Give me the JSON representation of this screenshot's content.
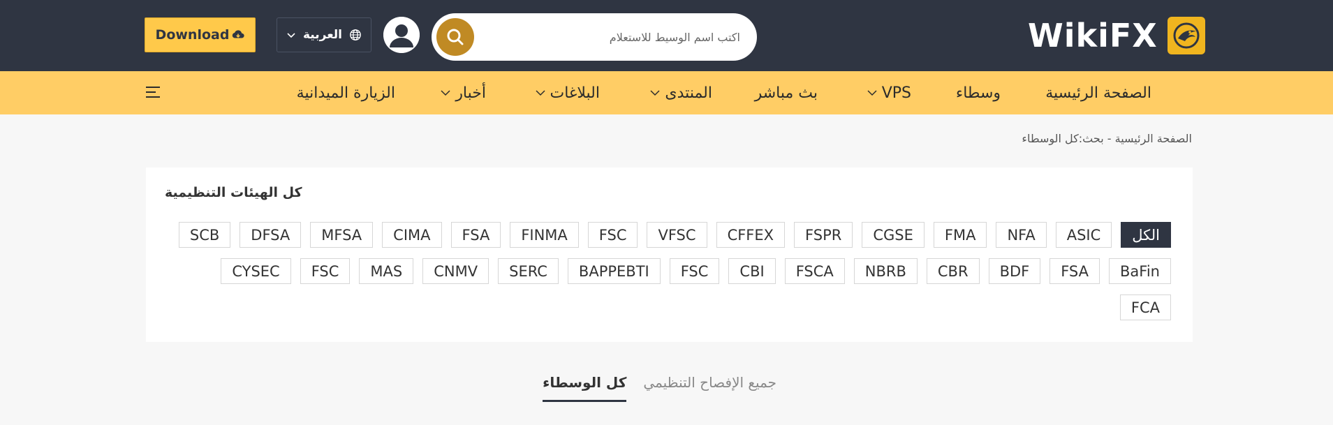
{
  "header": {
    "download_label": "Download",
    "language_label": "العربية",
    "search_placeholder": "اكتب اسم الوسيط للاستعلام",
    "logo_text": "WikiFX"
  },
  "nav": {
    "items": [
      {
        "label": "الصفحة الرئيسية",
        "dropdown": false
      },
      {
        "label": "وسطاء",
        "dropdown": false
      },
      {
        "label": "VPS",
        "dropdown": true
      },
      {
        "label": "بث مباشر",
        "dropdown": false
      },
      {
        "label": "المنتدى",
        "dropdown": true
      },
      {
        "label": "البلاغات",
        "dropdown": true
      },
      {
        "label": "أخبار",
        "dropdown": true
      },
      {
        "label": "الزيارة الميدانية",
        "dropdown": false
      }
    ]
  },
  "breadcrumb": {
    "home": "الصفحة الرئيسية",
    "separator": "-",
    "current": "بحث:كل الوسطاء"
  },
  "filter": {
    "title": "كل الهيئات التنظيمية",
    "rows": [
      [
        "الكل",
        "ASIC",
        "NFA",
        "FMA",
        "CGSE",
        "FSPR",
        "CFFEX",
        "VFSC",
        "FSC",
        "FINMA",
        "FSA",
        "CIMA",
        "MFSA",
        "DFSA",
        "SCB"
      ],
      [
        "BaFin",
        "FSA",
        "BDF",
        "CBR",
        "NBRB",
        "FSCA",
        "CBI",
        "FSC",
        "BAPPEBTI",
        "SERC",
        "CNMV",
        "MAS",
        "FSC",
        "CYSEC"
      ],
      [
        "FCA"
      ]
    ],
    "active": "الكل"
  },
  "tabs": {
    "items": [
      "كل الوسطاء",
      "جميع الإفصاح التنظيمي"
    ],
    "active_index": 0
  },
  "colors": {
    "header_bg": "#2f3542",
    "nav_bg": "#ffcd65",
    "accent": "#ffc94a",
    "search_button": "#c08a24"
  }
}
